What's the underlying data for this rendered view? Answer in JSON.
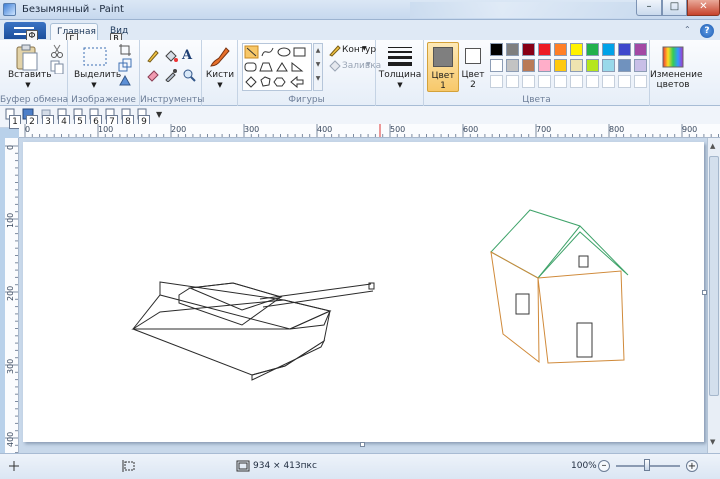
{
  "window": {
    "title": "Безымянный - Paint"
  },
  "tabs": {
    "file_keytip": "Ф",
    "home": "Главная",
    "home_keytip": "Г",
    "view": "Вид",
    "view_keytip": "В"
  },
  "ribbon": {
    "clipboard": {
      "paste_label": "Вставить",
      "group_label": "Буфер обмена"
    },
    "image": {
      "select_label": "Выделить",
      "group_label": "Изображение"
    },
    "tools": {
      "group_label": "Инструменты"
    },
    "brushes": {
      "label": "Кисти"
    },
    "shapes": {
      "outline_label": "Контур",
      "fill_label": "Заливка",
      "group_label": "Фигуры"
    },
    "size": {
      "label": "Толщина"
    },
    "color1": {
      "label": "Цвет",
      "num": "1"
    },
    "color2": {
      "label": "Цвет",
      "num": "2"
    },
    "colors_group_label": "Цвета",
    "edit_colors": {
      "line1": "Изменение",
      "line2": "цветов"
    }
  },
  "palette": {
    "row1": [
      "#000000",
      "#7f7f7f",
      "#880015",
      "#ed1c24",
      "#ff7f27",
      "#fff200",
      "#22b14c",
      "#00a2e8",
      "#3f48cc",
      "#a349a4"
    ],
    "row2": [
      "#ffffff",
      "#c3c3c3",
      "#b97a57",
      "#ffaec9",
      "#ffc90e",
      "#efe4b0",
      "#b5e61d",
      "#99d9ea",
      "#7092be",
      "#c8bfe7"
    ],
    "color1": "#7f7f7f",
    "color2": "#ffffff"
  },
  "quick_access": [
    "1",
    "2",
    "3",
    "4",
    "5",
    "6",
    "7",
    "8",
    "9"
  ],
  "ruler": {
    "h_labels": [
      "0",
      "100",
      "200",
      "300",
      "400",
      "500",
      "600",
      "700",
      "800",
      "900"
    ],
    "v_labels": [
      "0",
      "100",
      "200",
      "300",
      "400"
    ]
  },
  "status": {
    "canvas_size": "934 × 413пкс",
    "zoom": "100%"
  },
  "drawing_colors": {
    "tank": "#2b2b2b",
    "roof": "#3fa36a",
    "house": "#d08a3a",
    "windows": "#3a3a3a"
  }
}
